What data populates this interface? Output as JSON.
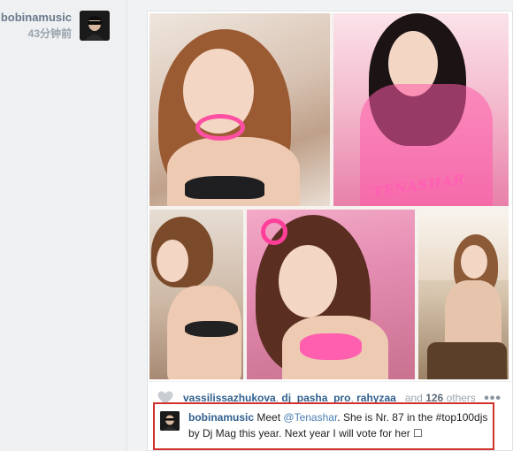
{
  "post": {
    "username": "bobinamusic",
    "time": "43分钟前",
    "photo_watermark": "TENASHAR"
  },
  "likes": {
    "users": [
      "vassilissazhukova",
      "dj_pasha_pro",
      "rahyzaa_"
    ],
    "and_text": "and",
    "count": "126",
    "suffix": "others li...",
    "more_label": "•••"
  },
  "comment": {
    "username": "bobinamusic",
    "pre": "Meet",
    "mention": "@Tenashar",
    "body": ". She is Nr. 87 in the #top100djs by Dj Mag this year. Next year I will vote for her ☐"
  },
  "colors": {
    "link": "#2f5f8f",
    "highlight_border": "#d0312d",
    "accent_pink": "#ff4fa3"
  }
}
